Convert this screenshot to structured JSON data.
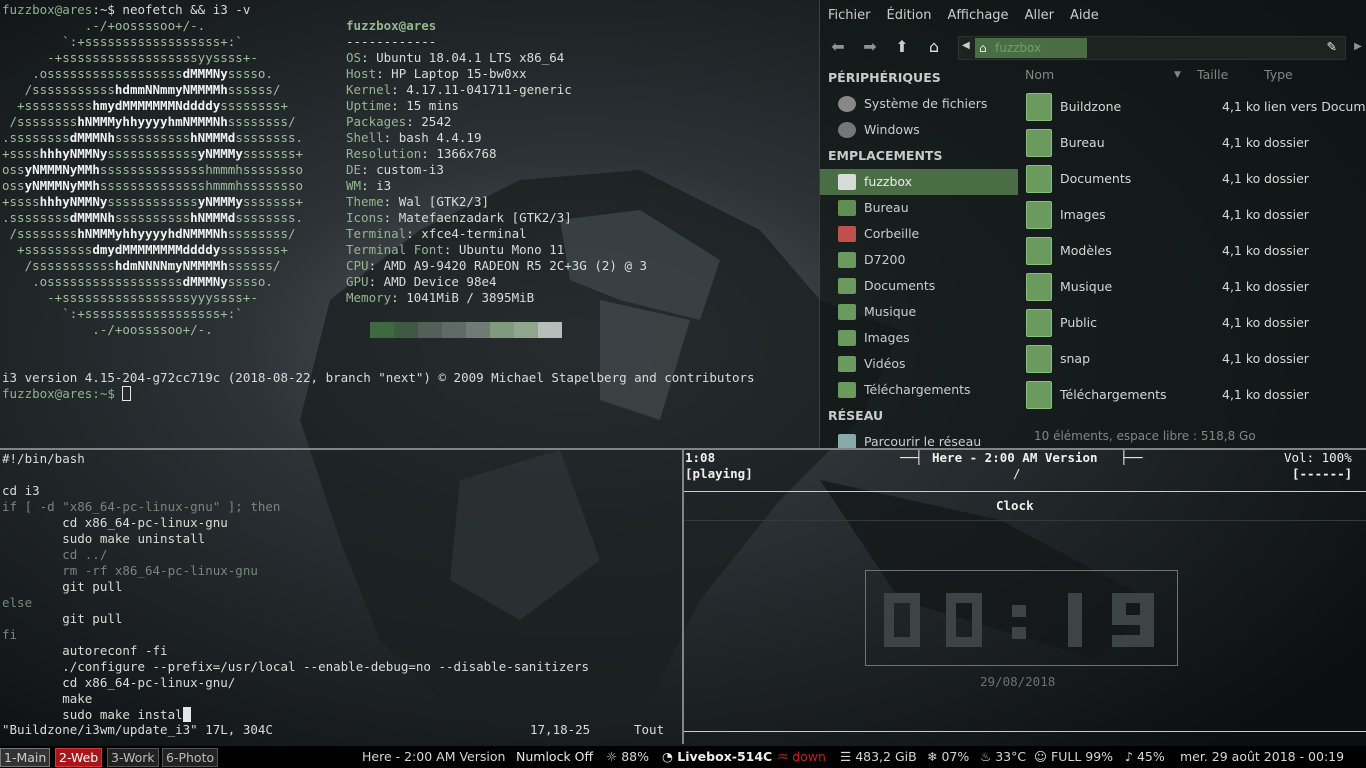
{
  "neofetch": {
    "prompt_user": "fuzzbox@ares",
    "prompt_path": ":~$",
    "command": "neofetch && i3 -v",
    "logo_lines": [
      "           .-/+oossssoo+/-.",
      "        `:+ssssssssssssssssss+:`",
      "      -+ssssssssssssssssssyyssss+-",
      "    .ossssssssssssssssssdMMMNysssso.",
      "   /ssssssssssshdmmNNmmyNMMMMhssssss/",
      "  +ssssssssshmydMMMMMMMNddddyssssssss+",
      " /sssssssshNMMMyhhyyyyhmNMMMNhssssssss/",
      ".ssssssssdMMMNhsssssssssshNMMMdssssssss.",
      "+sssshhhyNMMNyssssssssssssyNMMMysssssss+",
      "ossyNMMMNyMMhsssssssssssssshmmmhssssssso",
      "ossyNMMMNyMMhsssssssssssssshmmmhssssssso",
      "+sssshhhyNMMNyssssssssssssyNMMMysssssss+",
      ".ssssssssdMMMNhsssssssssshNMMMdssssssss.",
      " /sssssssshNMMMyhhyyyyhdNMMMNhssssssss/",
      "  +sssssssssdmydMMMMMMMMddddyssssssss+",
      "   /ssssssssssshdmNNNNmyNMMMMhssssss/",
      "    .ossssssssssssssssssdMMMNysssso.",
      "      -+sssssssssssssssssyyyssss+-",
      "        `:+ssssssssssssssssss+:`",
      "            .-/+oossssoo+/-."
    ],
    "user_host": "fuzzbox@ares",
    "divider": "------------",
    "info": [
      {
        "k": "OS",
        "v": "Ubuntu 18.04.1 LTS x86_64"
      },
      {
        "k": "Host",
        "v": "HP Laptop 15-bw0xx"
      },
      {
        "k": "Kernel",
        "v": "4.17.11-041711-generic"
      },
      {
        "k": "Uptime",
        "v": "15 mins"
      },
      {
        "k": "Packages",
        "v": "2542"
      },
      {
        "k": "Shell",
        "v": "bash 4.4.19"
      },
      {
        "k": "Resolution",
        "v": "1366x768"
      },
      {
        "k": "DE",
        "v": "custom-i3"
      },
      {
        "k": "WM",
        "v": "i3"
      },
      {
        "k": "Theme",
        "v": "Wal [GTK2/3]"
      },
      {
        "k": "Icons",
        "v": "Matefaenzadark [GTK2/3]"
      },
      {
        "k": "Terminal",
        "v": "xfce4-terminal"
      },
      {
        "k": "Terminal Font",
        "v": "Ubuntu Mono 11"
      },
      {
        "k": "CPU",
        "v": "AMD A9-9420 RADEON R5 2C+3G (2) @ 3"
      },
      {
        "k": "GPU",
        "v": "AMD Device 98e4"
      },
      {
        "k": "Memory",
        "v": "1041MiB / 3895MiB"
      }
    ],
    "palette_colors": [
      "#3d6b3f",
      "#3f5a43",
      "#53605a",
      "#5f6c66",
      "#6f7b75",
      "#7f9a7c",
      "#8fa58c",
      "#b7beba"
    ],
    "i3_version": "i3 version 4.15-204-g72cc719c (2018-08-22, branch \"next\") © 2009 Michael Stapelberg and contributors",
    "prompt2": "fuzzbox@ares:~$"
  },
  "filemanager": {
    "menu": [
      "Fichier",
      "Édition",
      "Affichage",
      "Aller",
      "Aide"
    ],
    "path_crumb": "fuzzbox",
    "sections": {
      "devices": "PÉRIPHÉRIQUES",
      "places": "EMPLACEMENTS",
      "network": "RÉSEAU"
    },
    "devices": [
      "Système de fichiers",
      "Windows"
    ],
    "places": [
      "fuzzbox",
      "Bureau",
      "Corbeille",
      "D7200",
      "Documents",
      "Musique",
      "Images",
      "Vidéos",
      "Téléchargements"
    ],
    "network": [
      "Parcourir le réseau"
    ],
    "columns": {
      "name": "Nom",
      "size": "Taille",
      "type": "Type"
    },
    "files": [
      {
        "name": "Buildzone",
        "size": "4,1 ko",
        "type": "lien vers Document"
      },
      {
        "name": "Bureau",
        "size": "4,1 ko",
        "type": "dossier"
      },
      {
        "name": "Documents",
        "size": "4,1 ko",
        "type": "dossier"
      },
      {
        "name": "Images",
        "size": "4,1 ko",
        "type": "dossier"
      },
      {
        "name": "Modèles",
        "size": "4,1 ko",
        "type": "dossier"
      },
      {
        "name": "Musique",
        "size": "4,1 ko",
        "type": "dossier"
      },
      {
        "name": "Public",
        "size": "4,1 ko",
        "type": "dossier"
      },
      {
        "name": "snap",
        "size": "4,1 ko",
        "type": "dossier"
      },
      {
        "name": "Téléchargements",
        "size": "4,1 ko",
        "type": "dossier"
      }
    ],
    "status": "10 éléments, espace libre : 518,8 Go"
  },
  "vim": {
    "lines": [
      "#!/bin/bash",
      "",
      "cd i3",
      "if [ -d \"x86_64-pc-linux-gnu\" ]; then",
      "        cd x86_64-pc-linux-gnu",
      "        sudo make uninstall",
      "        cd ../",
      "        rm -rf x86_64-pc-linux-gnu",
      "        git pull",
      "else",
      "        git pull",
      "fi",
      "        autoreconf -fi",
      "        ./configure --prefix=/usr/local --enable-debug=no --disable-sanitizers",
      "        cd x86_64-pc-linux-gnu/",
      "        make",
      "        sudo make instal"
    ],
    "status_file": "\"Buildzone/i3wm/update_i3\" 17L, 304C",
    "status_pos": "17,18-25",
    "status_scroll": "Tout"
  },
  "ncmpcpp": {
    "elapsed": "1:08",
    "state": "[playing]",
    "track": "Here - 2:00 AM Version",
    "slash": "/",
    "volume": "Vol: 100%",
    "flags": "[------]",
    "screen_title": "Clock",
    "clock_time": "00:19",
    "date": "29/08/2018"
  },
  "bar": {
    "workspaces": [
      "1-Main",
      "2-Web",
      "3-Work",
      "6-Photo"
    ],
    "now_playing": "Here - 2:00 AM Version",
    "numlock": "Numlock Off",
    "brightness": "88%",
    "wifi": "Livebox-514C",
    "eth": "down",
    "disk": "483,2 GiB",
    "load": "07%",
    "temp": "33°C",
    "battery": "FULL 99%",
    "volume": "45%",
    "datetime": "mer. 29 août 2018 - 00:19"
  }
}
